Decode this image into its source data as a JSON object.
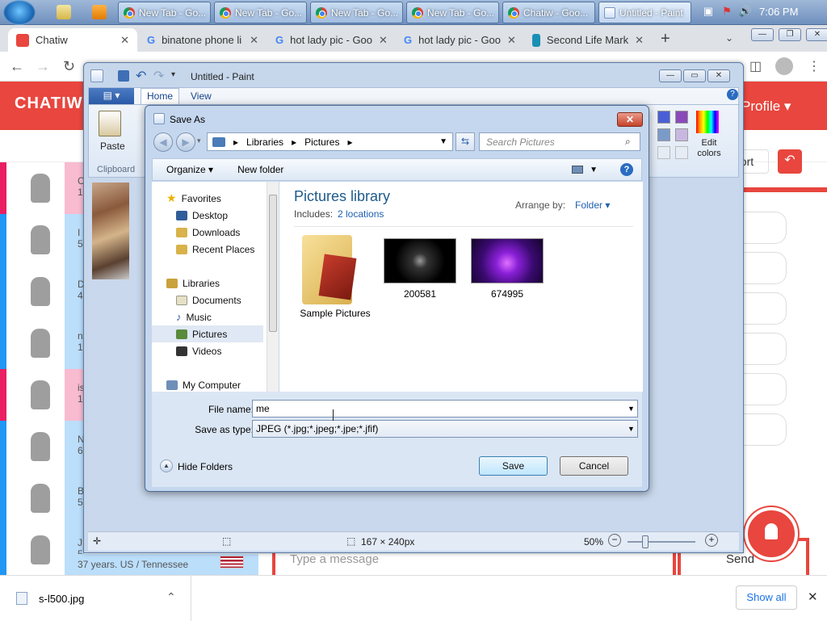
{
  "taskbar": {
    "time": "7:06 PM",
    "buttons": [
      {
        "label": "New Tab - Go..."
      },
      {
        "label": "New Tab - Go..."
      },
      {
        "label": "New Tab - Go..."
      },
      {
        "label": "New Tab - Go..."
      },
      {
        "label": "Chatiw - Goo..."
      },
      {
        "label": "Untitled - Paint"
      }
    ]
  },
  "browser": {
    "tabs": [
      {
        "label": "Chatiw"
      },
      {
        "label": "binatone phone li"
      },
      {
        "label": "hot lady pic - Goo"
      },
      {
        "label": "hot lady pic - Goo"
      },
      {
        "label": "Second Life Mark"
      }
    ],
    "new_tab": "+",
    "close_glyph": "✕"
  },
  "site": {
    "logo": "CHATIW",
    "profile_label": "Profile ▾",
    "support_label": "port",
    "user_numbers": [
      "1",
      "5",
      "4",
      "1",
      "1",
      "6",
      "5",
      "5"
    ],
    "user_initials": [
      "C",
      "I",
      "D",
      "n",
      "is",
      "N",
      "B",
      "J"
    ],
    "bottom_user": "37 years. US / Tennessee",
    "message_placeholder": "Type a message",
    "send_label": "Send"
  },
  "paint": {
    "title": "Untitled - Paint",
    "tabs": {
      "home": "Home",
      "view": "View"
    },
    "paste": "Paste",
    "clipboard": "Clipboard",
    "edit_colors": "Edit colors",
    "status_size": "167 × 240px",
    "zoom": "50%"
  },
  "dialog": {
    "title": "Save As",
    "breadcrumb": [
      "Libraries",
      "Pictures"
    ],
    "search_placeholder": "Search Pictures",
    "organize": "Organize ▾",
    "new_folder": "New folder",
    "nav": {
      "favorites": "Favorites",
      "desktop": "Desktop",
      "downloads": "Downloads",
      "recent": "Recent Places",
      "libraries": "Libraries",
      "documents": "Documents",
      "music": "Music",
      "pictures": "Pictures",
      "videos": "Videos",
      "computer": "My Computer"
    },
    "library_title": "Pictures library",
    "includes_label": "Includes:",
    "includes_link": "2 locations",
    "arrange_label": "Arrange by:",
    "arrange_value": "Folder ▾",
    "items": [
      {
        "label": "Sample Pictures"
      },
      {
        "label": "200581"
      },
      {
        "label": "674995"
      }
    ],
    "file_name_label": "File name:",
    "file_name_value": "me",
    "save_type_label": "Save as type:",
    "save_type_value": "JPEG (*.jpg;*.jpeg;*.jpe;*.jfif)",
    "hide_folders": "Hide Folders",
    "save": "Save",
    "cancel": "Cancel"
  },
  "downloads": {
    "file": "s-l500.jpg",
    "show_all": "Show all"
  }
}
